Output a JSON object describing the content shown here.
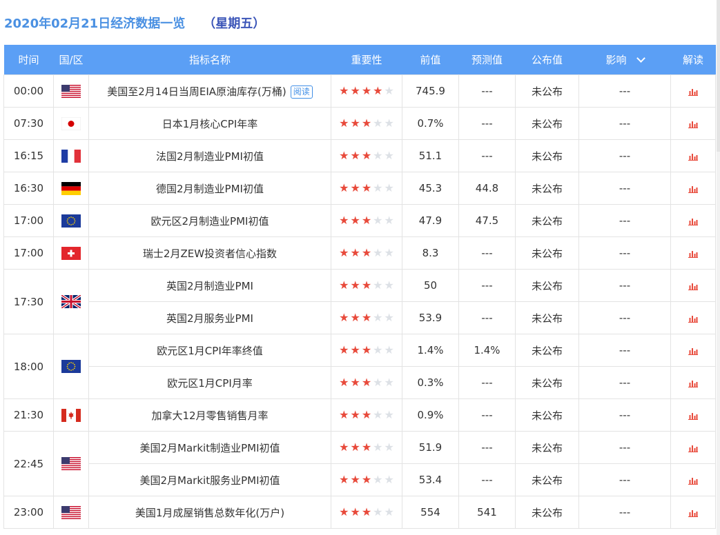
{
  "header": {
    "title": "2020年02月21日经济数据一览",
    "weekday": "（星期五）"
  },
  "columns": {
    "time": "时间",
    "country": "国/区",
    "name": "指标名称",
    "importance": "重要性",
    "prev": "前值",
    "forecast": "预测值",
    "actual": "公布值",
    "impact": "影响",
    "read": "解读"
  },
  "read_badge": "阅读",
  "icons": {
    "chart": "bar-chart-icon",
    "dropdown": "chevron-down-icon"
  },
  "colors": {
    "header_bg": "#5b9ff5",
    "accent_red": "#e84a3b",
    "title_blue": "#4a90e2",
    "badge_blue": "#3f8ee6"
  },
  "rows": [
    {
      "time": "00:00",
      "flag": "us",
      "rowspan": 1,
      "name": "美国至2月14日当周EIA原油库存(万桶)",
      "badge": true,
      "stars": 4,
      "prev": "745.9",
      "forecast": "---",
      "actual": "未公布",
      "impact": "---"
    },
    {
      "time": "07:30",
      "flag": "jp",
      "rowspan": 1,
      "name": "日本1月核心CPI年率",
      "stars": 3,
      "prev": "0.7%",
      "forecast": "---",
      "actual": "未公布",
      "impact": "---"
    },
    {
      "time": "16:15",
      "flag": "fr",
      "rowspan": 1,
      "name": "法国2月制造业PMI初值",
      "stars": 3,
      "prev": "51.1",
      "forecast": "---",
      "actual": "未公布",
      "impact": "---"
    },
    {
      "time": "16:30",
      "flag": "de",
      "rowspan": 1,
      "name": "德国2月制造业PMI初值",
      "stars": 3,
      "prev": "45.3",
      "forecast": "44.8",
      "actual": "未公布",
      "impact": "---"
    },
    {
      "time": "17:00",
      "flag": "eu",
      "rowspan": 1,
      "name": "欧元区2月制造业PMI初值",
      "stars": 3,
      "prev": "47.9",
      "forecast": "47.5",
      "actual": "未公布",
      "impact": "---"
    },
    {
      "time": "17:00",
      "flag": "ch",
      "rowspan": 1,
      "name": "瑞士2月ZEW投资者信心指数",
      "stars": 3,
      "prev": "8.3",
      "forecast": "---",
      "actual": "未公布",
      "impact": "---"
    },
    {
      "time": "17:30",
      "flag": "uk",
      "rowspan": 2,
      "name": "英国2月制造业PMI",
      "stars": 3,
      "prev": "50",
      "forecast": "---",
      "actual": "未公布",
      "impact": "---"
    },
    {
      "time": null,
      "name": "英国2月服务业PMI",
      "stars": 3,
      "prev": "53.9",
      "forecast": "---",
      "actual": "未公布",
      "impact": "---"
    },
    {
      "time": "18:00",
      "flag": "eu",
      "rowspan": 2,
      "name": "欧元区1月CPI年率终值",
      "stars": 3,
      "prev": "1.4%",
      "forecast": "1.4%",
      "actual": "未公布",
      "impact": "---"
    },
    {
      "time": null,
      "name": "欧元区1月CPI月率",
      "stars": 3,
      "prev": "0.3%",
      "forecast": "---",
      "actual": "未公布",
      "impact": "---"
    },
    {
      "time": "21:30",
      "flag": "ca",
      "rowspan": 1,
      "name": "加拿大12月零售销售月率",
      "stars": 3,
      "prev": "0.9%",
      "forecast": "---",
      "actual": "未公布",
      "impact": "---"
    },
    {
      "time": "22:45",
      "flag": "us",
      "rowspan": 2,
      "name": "美国2月Markit制造业PMI初值",
      "stars": 3,
      "prev": "51.9",
      "forecast": "---",
      "actual": "未公布",
      "impact": "---"
    },
    {
      "time": null,
      "name": "美国2月Markit服务业PMI初值",
      "stars": 3,
      "prev": "53.4",
      "forecast": "---",
      "actual": "未公布",
      "impact": "---"
    },
    {
      "time": "23:00",
      "flag": "us",
      "rowspan": 1,
      "name": "美国1月成屋销售总数年化(万户)",
      "stars": 3,
      "prev": "554",
      "forecast": "541",
      "actual": "未公布",
      "impact": "---"
    }
  ]
}
